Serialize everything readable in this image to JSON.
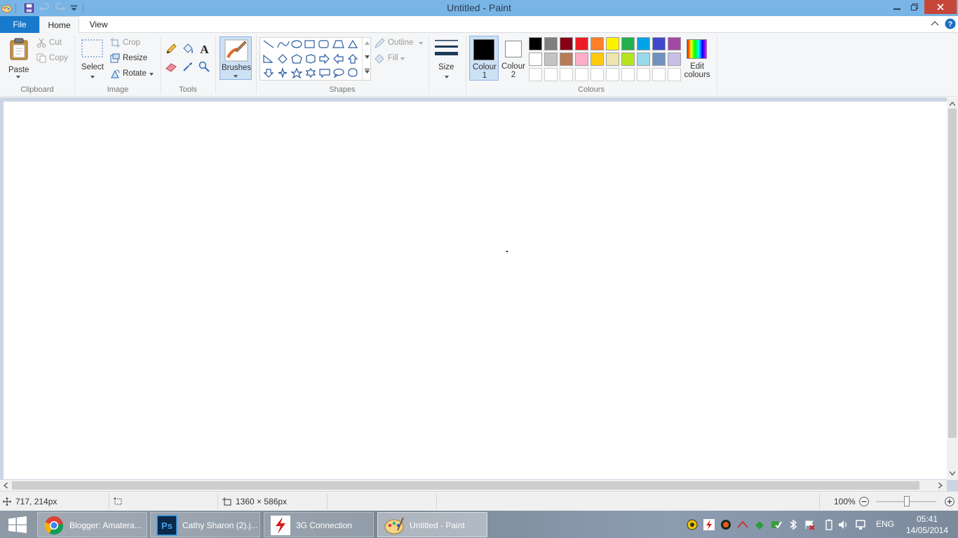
{
  "window": {
    "title": "Untitled - Paint"
  },
  "tabs": {
    "file": "File",
    "home": "Home",
    "view": "View"
  },
  "clipboard": {
    "paste": "Paste",
    "cut": "Cut",
    "copy": "Copy",
    "group": "Clipboard"
  },
  "image": {
    "select": "Select",
    "crop": "Crop",
    "resize": "Resize",
    "rotate": "Rotate",
    "group": "Image"
  },
  "tools": {
    "group": "Tools",
    "text_icon": "A"
  },
  "brushes": {
    "label": "Brushes"
  },
  "shapes": {
    "outline": "Outline",
    "fill": "Fill",
    "group": "Shapes"
  },
  "size": {
    "label": "Size"
  },
  "colours": {
    "colour1": "Colour 1",
    "colour2": "Colour 2",
    "edit": "Edit colours",
    "group": "Colours",
    "colour1_value": "#000000",
    "colour2_value": "#ffffff",
    "palette_row1": [
      "#000000",
      "#7f7f7f",
      "#880015",
      "#ed1c24",
      "#ff7f27",
      "#fff200",
      "#22b14c",
      "#00a2e8",
      "#3f48cc",
      "#a349a4"
    ],
    "palette_row2": [
      "#ffffff",
      "#c3c3c3",
      "#b97a57",
      "#ffaec9",
      "#ffc90e",
      "#efe4b0",
      "#b5e61d",
      "#99d9ea",
      "#7092be",
      "#c8bfe7"
    ]
  },
  "status": {
    "cursor_pos": "717, 214px",
    "canvas_size": "1360 × 586px",
    "zoom": "100%"
  },
  "taskbar": {
    "items": [
      {
        "label": "Blogger: Amatera..."
      },
      {
        "label": "Cathy Sharon (2).j..."
      },
      {
        "label": "3G Connection"
      },
      {
        "label": "Untitled - Paint"
      }
    ],
    "ps_text": "Ps",
    "lang": "ENG",
    "time": "05:41",
    "date": "14/05/2014"
  }
}
